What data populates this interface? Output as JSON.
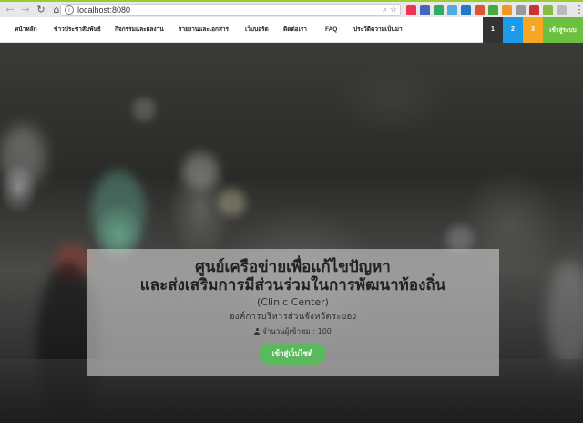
{
  "browser": {
    "url": "localhost:8080",
    "colors": {
      "top_accent": "#9acd32",
      "chrome_bg": "#e8e8e8"
    },
    "icons": [
      "back-icon",
      "forward-icon",
      "reload-icon",
      "home-icon",
      "info-icon",
      "search-icon",
      "star-icon"
    ]
  },
  "nav": {
    "items": [
      {
        "label": "หน้าหลัก"
      },
      {
        "label": "ข่าวประชาสัมพันธ์"
      },
      {
        "label": "กิจกรรมและผลงาน"
      },
      {
        "label": "รายงานและเอกสาร"
      },
      {
        "label": "เว็บบอร์ด"
      },
      {
        "label": "ติดต่อเรา"
      },
      {
        "label": "FAQ"
      },
      {
        "label": "ประวัติความเป็นมา"
      }
    ],
    "squares": [
      {
        "label": "1",
        "color": "#333333"
      },
      {
        "label": "2",
        "color": "#1e9be8"
      },
      {
        "label": "3",
        "color": "#f5a623"
      }
    ],
    "login_label": "เข้าสู่ระบบ",
    "login_color": "#6cbf3f"
  },
  "hero": {
    "title_line1": "ศูนย์เครือข่ายเพื่อแก้ไขปัญหา",
    "title_line2": "และส่งเสริมการมีส่วนร่วมในการพัฒนาท้องถิ่น",
    "subtitle": "(Clinic Center)",
    "org": "องค์การบริหารส่วนจังหวัดระยอง",
    "visitors": "จำนวนผู้เข้าชม : 100",
    "visitor_icon": "person-icon",
    "enter_button": "เข้าสู่เว็บไซต์",
    "enter_color": "#5cb85c"
  }
}
